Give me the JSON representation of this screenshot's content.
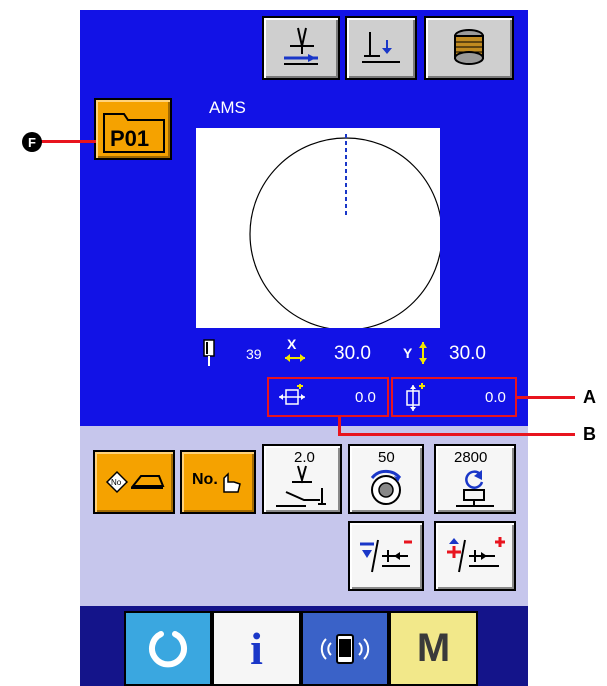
{
  "top_toolbar": {
    "thread_clamp_icon": "thread-clamp-icon",
    "presser_icon": "presser-lower-icon",
    "bobbin_icon": "bobbin-winder-icon"
  },
  "pattern_folder": {
    "label": "P01"
  },
  "pattern_name": "AMS",
  "preview": {
    "shape": "circle"
  },
  "needle_count": "39",
  "x_scale": {
    "label": "X",
    "value": "30.0"
  },
  "y_scale": {
    "label": "Y",
    "value": "30.0"
  },
  "move_x": {
    "value": "0.0"
  },
  "move_y": {
    "value": "0.0"
  },
  "tension_button": {
    "value": "2.0"
  },
  "presser_height_button": {
    "value": "50"
  },
  "max_speed_button": {
    "value": "2800"
  },
  "bottom_bar": {
    "reset_icon": "reset-icon",
    "info_label": "i",
    "communication_icon": "communication-icon",
    "mode_label": "M"
  },
  "callouts": {
    "f": "F",
    "a": "A",
    "b": "B"
  },
  "colors": {
    "panel_blue": "#1212e6",
    "panel_lilac": "#c6c6ec",
    "panel_bottom": "#14148a",
    "button_orange": "#f5a200",
    "callout_red": "#e8141e"
  }
}
